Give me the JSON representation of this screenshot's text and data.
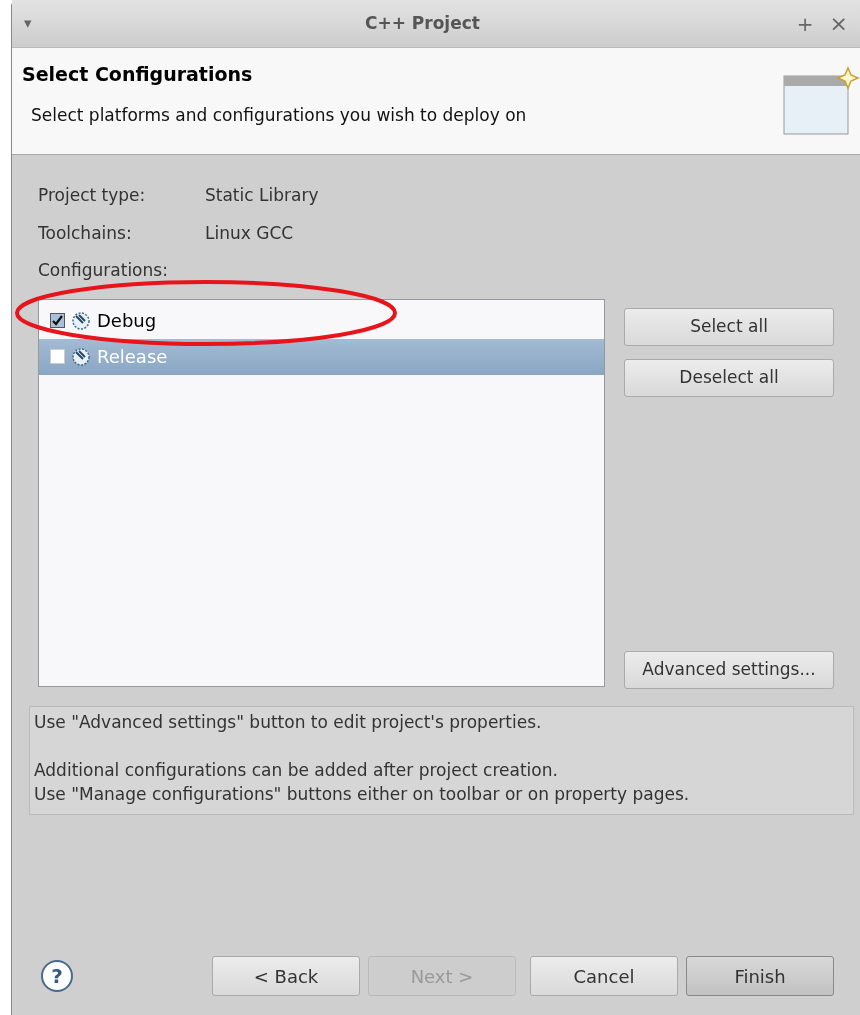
{
  "window": {
    "title": "C++ Project",
    "menu_glyph": "▾",
    "maximize_glyph": "+",
    "close_glyph": "×"
  },
  "header": {
    "title": "Select Configurations",
    "description": "Select platforms and configurations you wish to deploy on"
  },
  "info": [
    {
      "label": "Project type:",
      "value": "Static Library"
    },
    {
      "label": "Toolchains:",
      "value": "Linux GCC"
    }
  ],
  "configurations_label": "Configurations:",
  "configurations": [
    {
      "name": "Debug",
      "checked": true,
      "selected": false
    },
    {
      "name": "Release",
      "checked": false,
      "selected": true
    }
  ],
  "side_buttons": [
    "Select all",
    "Deselect all"
  ],
  "advanced_button": "Advanced settings...",
  "message_paragraphs": [
    [
      "Use \"Advanced settings\" button to edit project's properties."
    ],
    [
      "Additional configurations can be added after project creation.",
      "Use \"Manage configurations\" buttons either on toolbar or on property pages."
    ]
  ],
  "help_glyph": "?",
  "buttons": [
    {
      "label": "< Back",
      "disabled": false,
      "default": false
    },
    {
      "label": "Next >",
      "disabled": true,
      "default": false
    },
    {
      "label": "Cancel",
      "disabled": false,
      "default": false
    },
    {
      "label": "Finish",
      "disabled": false,
      "default": true
    }
  ]
}
